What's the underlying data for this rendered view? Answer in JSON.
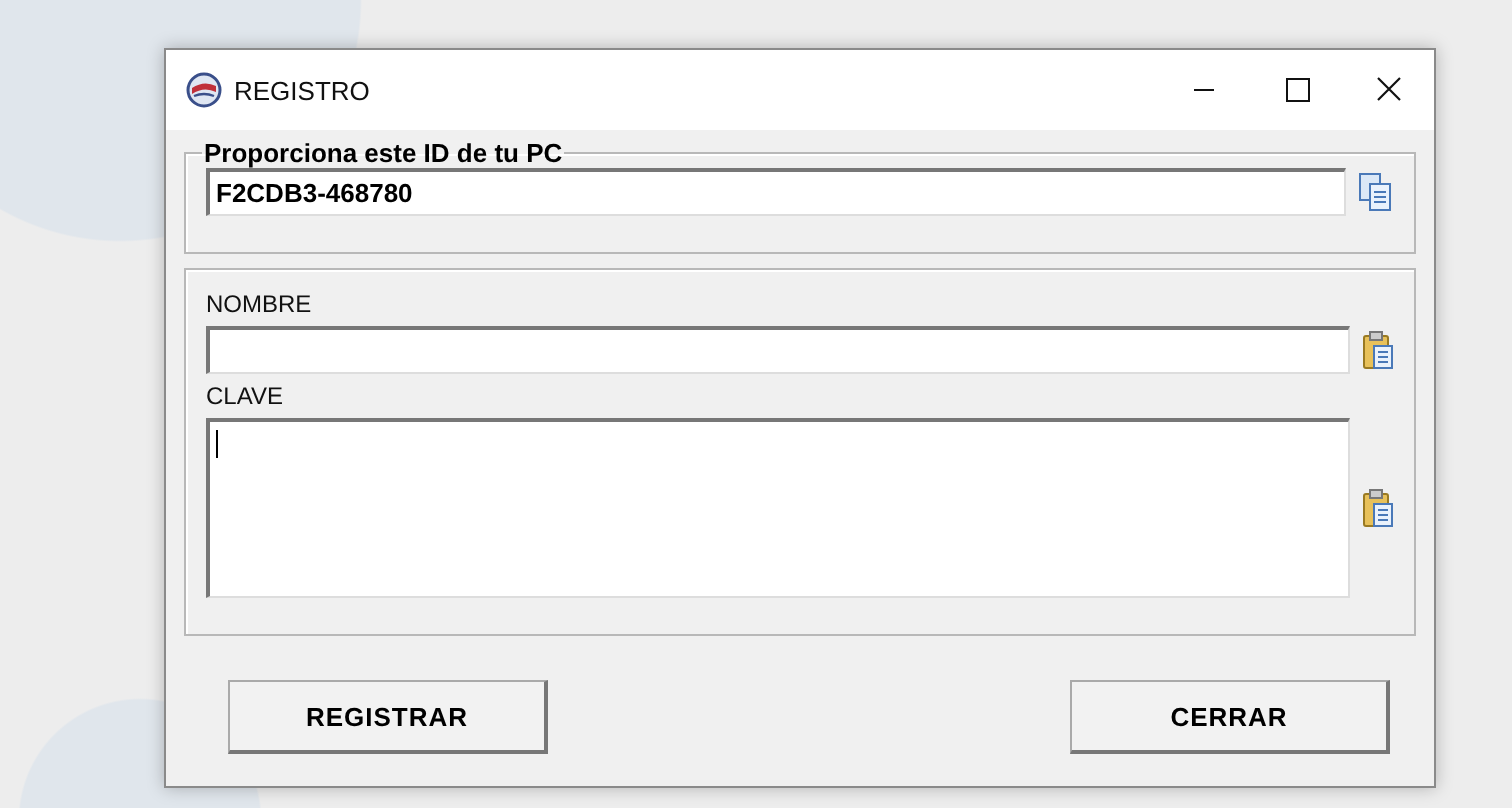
{
  "window": {
    "title": "REGISTRO"
  },
  "id_group": {
    "legend": "Proporciona este ID de tu PC",
    "value": "F2CDB3-468780"
  },
  "fields": [
    {
      "label": "NOMBRE",
      "kind": "line",
      "focused": false
    },
    {
      "label": "CLAVE",
      "kind": "multiline",
      "focused": true
    }
  ],
  "buttons": [
    "REGISTRAR",
    "CERRAR"
  ]
}
